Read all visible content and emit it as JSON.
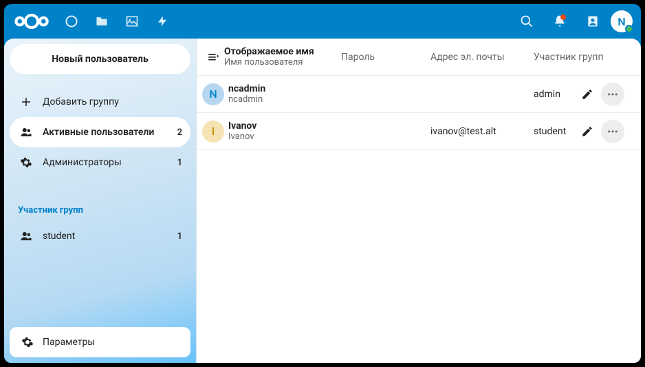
{
  "header": {
    "avatar_initial": "N"
  },
  "sidebar": {
    "new_user": "Новый пользователь",
    "add_group": "Добавить группу",
    "active_users": {
      "label": "Активные пользователи",
      "count": "2"
    },
    "admins": {
      "label": "Администраторы",
      "count": "1"
    },
    "groups_heading": "Участник групп",
    "groups": [
      {
        "label": "student",
        "count": "1"
      }
    ],
    "settings": "Параметры"
  },
  "table": {
    "head": {
      "display_name": "Отображаемое имя",
      "username": "Имя пользователя",
      "password": "Пароль",
      "email": "Адрес эл. почты",
      "groups": "Участник групп"
    },
    "rows": [
      {
        "avatar_letter": "N",
        "avatar_bg": "#b7d6ef",
        "avatar_fg": "#0082c9",
        "display_name": "ncadmin",
        "username": "ncadmin",
        "password": "",
        "email": "",
        "groups": "admin"
      },
      {
        "avatar_letter": "I",
        "avatar_bg": "#f5e3b3",
        "avatar_fg": "#c49000",
        "display_name": "Ivanov",
        "username": "Ivanov",
        "password": "",
        "email": "ivanov@test.alt",
        "groups": "student"
      }
    ]
  }
}
